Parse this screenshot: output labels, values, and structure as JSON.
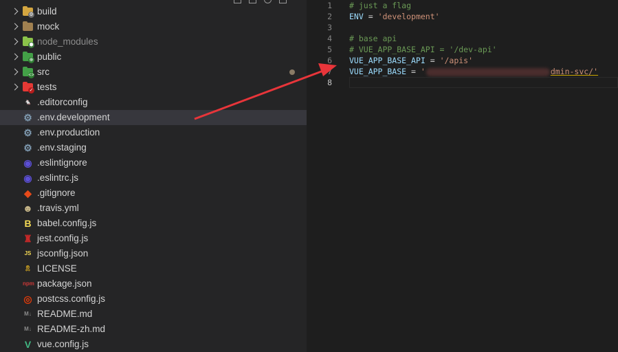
{
  "explorer": {
    "items": [
      {
        "label": "build",
        "type": "folder",
        "icon": "folder-build-icon",
        "color": "#d4a640",
        "badge": "⚙",
        "badge_color": "#6b6b6b"
      },
      {
        "label": "mock",
        "type": "folder",
        "icon": "folder-mock-icon",
        "color": "#a08050",
        "badge": "",
        "badge_color": ""
      },
      {
        "label": "node_modules",
        "type": "folder",
        "icon": "folder-node-icon",
        "color": "#8bc34a",
        "badge": "⬢",
        "badge_color": "#3e7a3e",
        "dimmed": true
      },
      {
        "label": "public",
        "type": "folder",
        "icon": "folder-public-icon",
        "color": "#43a047",
        "badge": "⊕",
        "badge_color": "#2e7d32"
      },
      {
        "label": "src",
        "type": "folder",
        "icon": "folder-src-icon",
        "color": "#43a047",
        "badge": "<>",
        "badge_color": "#2e7d32",
        "modified": true
      },
      {
        "label": "tests",
        "type": "folder",
        "icon": "folder-tests-icon",
        "color": "#e53935",
        "badge": "✓",
        "badge_color": "#b71c1c"
      },
      {
        "label": ".editorconfig",
        "type": "file",
        "icon": "editorconfig-icon",
        "glyph": "🐁",
        "color": "#e0e0e0"
      },
      {
        "label": ".env.development",
        "type": "file",
        "icon": "gear-icon",
        "glyph": "⚙",
        "color": "#7f9ab0",
        "active": true
      },
      {
        "label": ".env.production",
        "type": "file",
        "icon": "gear-icon",
        "glyph": "⚙",
        "color": "#7f9ab0"
      },
      {
        "label": ".env.staging",
        "type": "file",
        "icon": "gear-icon",
        "glyph": "⚙",
        "color": "#7f9ab0"
      },
      {
        "label": ".eslintignore",
        "type": "file",
        "icon": "eslint-icon",
        "glyph": "◉",
        "color": "#5c4fd6"
      },
      {
        "label": ".eslintrc.js",
        "type": "file",
        "icon": "eslint-icon",
        "glyph": "◉",
        "color": "#5c4fd6"
      },
      {
        "label": ".gitignore",
        "type": "file",
        "icon": "git-icon",
        "glyph": "◆",
        "color": "#e64a19"
      },
      {
        "label": ".travis.yml",
        "type": "file",
        "icon": "travis-icon",
        "glyph": "☻",
        "color": "#c9b88a"
      },
      {
        "label": "babel.config.js",
        "type": "file",
        "icon": "babel-icon",
        "glyph": "B",
        "color": "#f5da55"
      },
      {
        "label": "jest.config.js",
        "type": "file",
        "icon": "jest-icon",
        "glyph": "♜",
        "color": "#c62828"
      },
      {
        "label": "jsconfig.json",
        "type": "file",
        "icon": "js-icon",
        "glyph": "JS",
        "color": "#f5da55"
      },
      {
        "label": "LICENSE",
        "type": "file",
        "icon": "license-icon",
        "glyph": "🎗",
        "color": "#e6b422"
      },
      {
        "label": "package.json",
        "type": "file",
        "icon": "npm-icon",
        "glyph": "npm",
        "color": "#cb3837"
      },
      {
        "label": "postcss.config.js",
        "type": "file",
        "icon": "postcss-icon",
        "glyph": "◎",
        "color": "#dd3a0a"
      },
      {
        "label": "README.md",
        "type": "file",
        "icon": "markdown-icon",
        "glyph": "M↓",
        "color": "#8a8a8a"
      },
      {
        "label": "README-zh.md",
        "type": "file",
        "icon": "markdown-icon",
        "glyph": "M↓",
        "color": "#8a8a8a"
      },
      {
        "label": "vue.config.js",
        "type": "file",
        "icon": "vue-icon",
        "glyph": "V",
        "color": "#41b883"
      }
    ]
  },
  "editor": {
    "lines": [
      {
        "n": "1",
        "parts": [
          {
            "t": "# just a flag",
            "c": "c-comment"
          }
        ]
      },
      {
        "n": "2",
        "parts": [
          {
            "t": "ENV",
            "c": "c-key"
          },
          {
            "t": " = ",
            "c": "c-op"
          },
          {
            "t": "'development'",
            "c": "c-str"
          }
        ]
      },
      {
        "n": "3",
        "parts": []
      },
      {
        "n": "4",
        "parts": [
          {
            "t": "# base api",
            "c": "c-comment"
          }
        ]
      },
      {
        "n": "5",
        "parts": [
          {
            "t": "# VUE_APP_BASE_API = '/dev-api'",
            "c": "c-comment"
          }
        ]
      },
      {
        "n": "6",
        "parts": [
          {
            "t": "VUE_APP_BASE_API",
            "c": "c-key"
          },
          {
            "t": " = ",
            "c": "c-op"
          },
          {
            "t": "'/apis'",
            "c": "c-str"
          }
        ]
      },
      {
        "n": "7",
        "parts": [
          {
            "t": "VUE_APP_BASE",
            "c": "c-key"
          },
          {
            "t": " = ",
            "c": "c-op"
          },
          {
            "t": "'",
            "c": "c-str"
          },
          {
            "redact": true
          },
          {
            "t": "dmin-svc/'",
            "c": "c-str c-warn"
          }
        ]
      },
      {
        "n": "8",
        "parts": [],
        "current": true
      }
    ]
  },
  "colors": {
    "arrow": "#e8353a",
    "sidebar_bg": "#252526",
    "editor_bg": "#1e1e1e",
    "active_row": "#37373d"
  }
}
